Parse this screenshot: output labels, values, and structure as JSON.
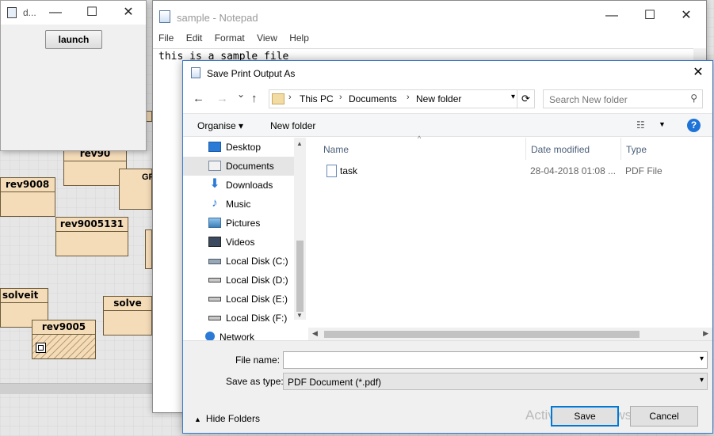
{
  "background": {
    "classes": [
      "rev90",
      "rev9008",
      "rev9005131",
      "solveit",
      "solve",
      "rev9005"
    ],
    "fragment_label": "GF",
    "colors": {
      "class_fill": "#f5dcb9",
      "class_border": "#6b5a3a"
    }
  },
  "launcher": {
    "title": "d...",
    "launch_label": "launch",
    "controls": {
      "minimize": "—",
      "maximize": "☐",
      "close": "✕"
    }
  },
  "notepad": {
    "title": "sample - Notepad",
    "menu": [
      "File",
      "Edit",
      "Format",
      "View",
      "Help"
    ],
    "content": "this is a sample file",
    "controls": {
      "minimize": "—",
      "maximize": "☐",
      "close": "✕"
    }
  },
  "dialog": {
    "title": "Save Print Output As",
    "close": "✕",
    "nav": {
      "back": "←",
      "forward": "→",
      "recent": "⌄",
      "up": "↑"
    },
    "breadcrumb": [
      "This PC",
      "Documents",
      "New folder"
    ],
    "search_placeholder": "Search New folder",
    "toolbar": {
      "organise": "Organise ▾",
      "new_folder": "New folder",
      "help": "?"
    },
    "sidebar": [
      {
        "label": "Desktop",
        "icon": "desktop-icon"
      },
      {
        "label": "Documents",
        "icon": "documents-icon",
        "selected": true
      },
      {
        "label": "Downloads",
        "icon": "downloads-icon"
      },
      {
        "label": "Music",
        "icon": "music-icon"
      },
      {
        "label": "Pictures",
        "icon": "pictures-icon"
      },
      {
        "label": "Videos",
        "icon": "videos-icon"
      },
      {
        "label": "Local Disk (C:)",
        "icon": "disk-c-icon"
      },
      {
        "label": "Local Disk (D:)",
        "icon": "disk-icon"
      },
      {
        "label": "Local Disk (E:)",
        "icon": "disk-icon"
      },
      {
        "label": "Local Disk (F:)",
        "icon": "disk-icon"
      },
      {
        "label": "Network",
        "icon": "network-icon"
      }
    ],
    "columns": [
      "Name",
      "Date modified",
      "Type"
    ],
    "files": [
      {
        "name": "task",
        "date": "28-04-2018 01:08 ...",
        "type": "PDF File"
      }
    ],
    "file_name_label": "File name:",
    "file_name_value": "",
    "save_type_label": "Save as type:",
    "save_type_value": "PDF Document (*.pdf)",
    "hide_folders": "Hide Folders",
    "save": "Save",
    "cancel": "Cancel",
    "watermark": "Activate Windows",
    "accent": "#0078d7"
  }
}
